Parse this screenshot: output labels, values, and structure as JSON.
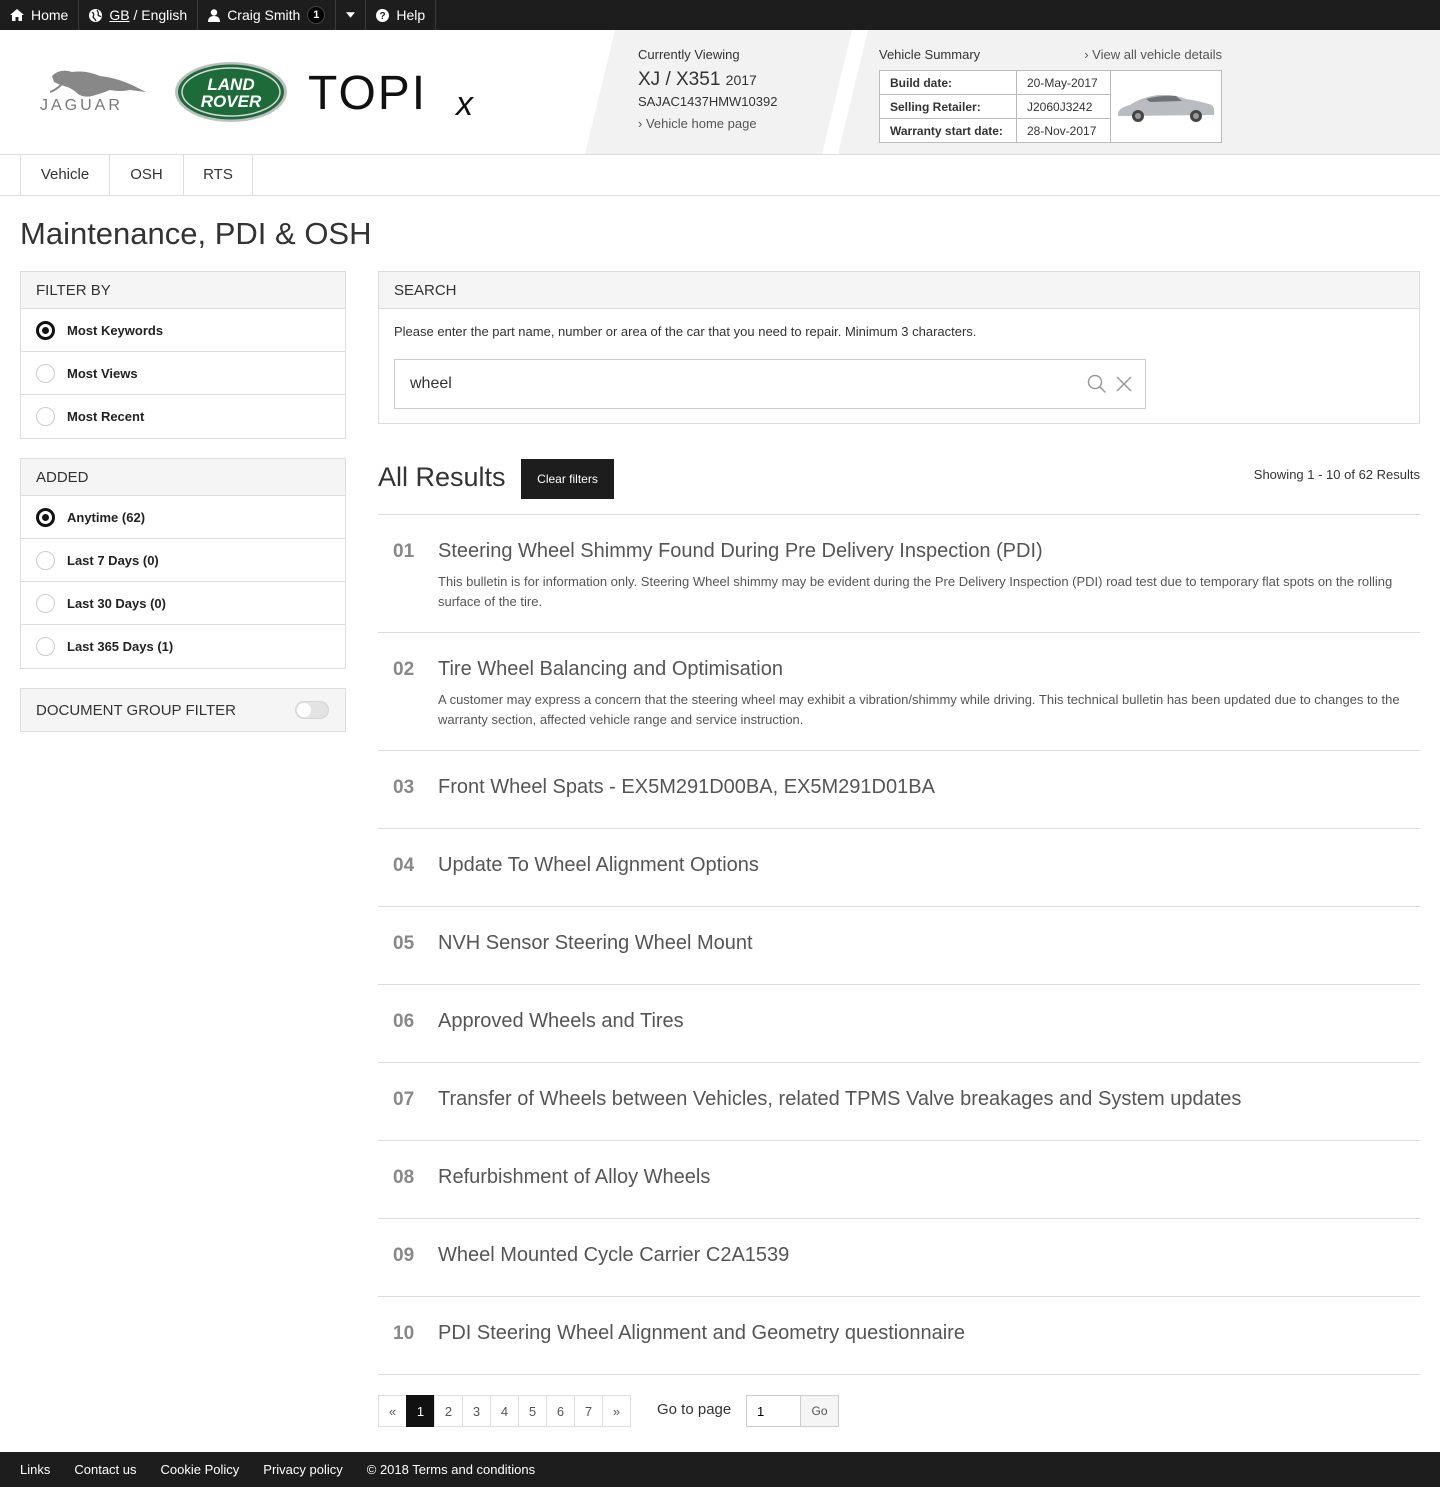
{
  "topbar": {
    "home": "Home",
    "region": "GB",
    "language_sep": " / English",
    "user": "Craig Smith",
    "notifications": "1",
    "help": "Help"
  },
  "header": {
    "logos": {
      "jaguar": "JAGUAR",
      "landrover_line1": "LAND",
      "landrover_line2": "ROVER",
      "topix": "TOPI",
      "topix_x": "x"
    },
    "currently_viewing": {
      "label": "Currently Viewing",
      "model": "XJ / X351",
      "year": "2017",
      "vin": "SAJAC1437HMW10392",
      "link": "Vehicle home page"
    },
    "vehicle_summary": {
      "label": "Vehicle Summary",
      "link": "View all vehicle details",
      "rows": [
        {
          "key": "Build date:",
          "value": "20-May-2017"
        },
        {
          "key": "Selling Retailer:",
          "value": "J2060J3242"
        },
        {
          "key": "Warranty start date:",
          "value": "28-Nov-2017"
        }
      ]
    }
  },
  "tabs": [
    "Vehicle",
    "OSH",
    "RTS"
  ],
  "page_title": "Maintenance, PDI & OSH",
  "filter_by": {
    "title": "FILTER BY",
    "options": [
      {
        "label": "Most Keywords",
        "selected": true
      },
      {
        "label": "Most Views",
        "selected": false
      },
      {
        "label": "Most Recent",
        "selected": false
      }
    ]
  },
  "added": {
    "title": "ADDED",
    "options": [
      {
        "label": "Anytime (62)",
        "selected": true
      },
      {
        "label": "Last 7 Days (0)",
        "selected": false
      },
      {
        "label": "Last 30 Days (0)",
        "selected": false
      },
      {
        "label": "Last 365 Days (1)",
        "selected": false
      }
    ]
  },
  "document_group_filter": {
    "label": "DOCUMENT GROUP FILTER",
    "enabled": false
  },
  "search": {
    "title": "SEARCH",
    "hint": "Please enter the part name, number or area of the car that you need to repair. Minimum 3 characters.",
    "value": "wheel",
    "placeholder": ""
  },
  "results": {
    "title": "All Results",
    "clear_filters": "Clear filters",
    "showing": "Showing 1 - 10 of 62 Results",
    "items": [
      {
        "num": "01",
        "title": "Steering Wheel Shimmy Found During Pre Delivery Inspection (PDI)",
        "desc": "This bulletin is for information only. Steering Wheel shimmy may be evident during the Pre Delivery Inspection (PDI) road test due to temporary flat spots on the rolling surface of the tire."
      },
      {
        "num": "02",
        "title": "Tire Wheel Balancing and Optimisation",
        "desc": "A customer may express a concern that the steering wheel may exhibit a vibration/shimmy while driving. This technical bulletin has been updated due to changes to the warranty section, affected vehicle range and service instruction."
      },
      {
        "num": "03",
        "title": "Front Wheel Spats - EX5M291D00BA, EX5M291D01BA",
        "desc": ""
      },
      {
        "num": "04",
        "title": "Update To Wheel Alignment Options",
        "desc": ""
      },
      {
        "num": "05",
        "title": "NVH Sensor Steering Wheel Mount",
        "desc": ""
      },
      {
        "num": "06",
        "title": "Approved Wheels and Tires",
        "desc": ""
      },
      {
        "num": "07",
        "title": "Transfer of Wheels between Vehicles, related TPMS Valve breakages and System updates",
        "desc": ""
      },
      {
        "num": "08",
        "title": "Refurbishment of Alloy Wheels",
        "desc": ""
      },
      {
        "num": "09",
        "title": "Wheel Mounted Cycle Carrier C2A1539",
        "desc": ""
      },
      {
        "num": "10",
        "title": "PDI Steering Wheel Alignment and Geometry questionnaire",
        "desc": ""
      }
    ]
  },
  "pagination": {
    "prev": "«",
    "next": "»",
    "pages": [
      "1",
      "2",
      "3",
      "4",
      "5",
      "6",
      "7"
    ],
    "current": "1",
    "goto_label": "Go to page",
    "goto_value": "1",
    "go_button": "Go"
  },
  "footer": [
    "Links",
    "Contact us",
    "Cookie Policy",
    "Privacy policy",
    "© 2018 Terms and conditions"
  ],
  "colors": {
    "topbar": "#1d1d1d",
    "header_grey": "#f2f2f2",
    "landrover_green": "#1e6b3a",
    "button_dark": "#1d1d1d"
  }
}
